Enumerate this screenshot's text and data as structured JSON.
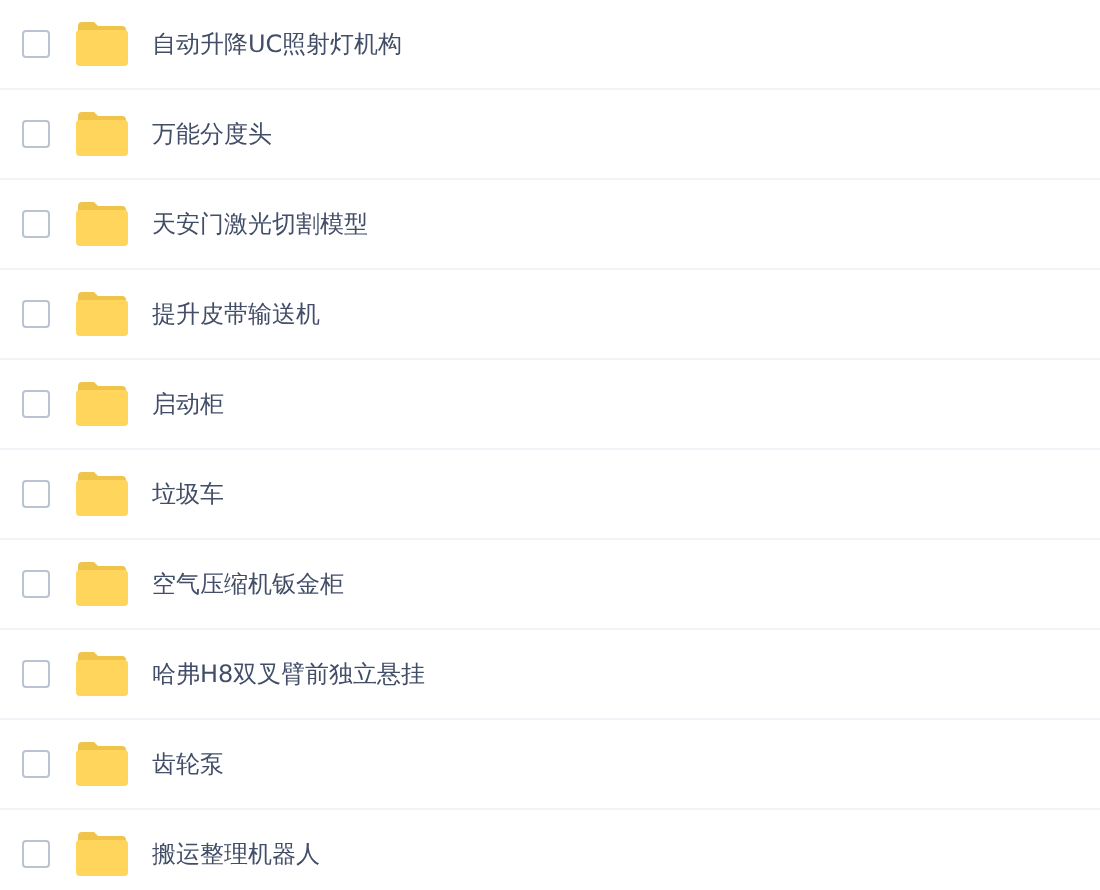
{
  "files": [
    {
      "name": "自动升降UC照射灯机构",
      "checked": false
    },
    {
      "name": "万能分度头",
      "checked": false
    },
    {
      "name": "天安门激光切割模型",
      "checked": false
    },
    {
      "name": "提升皮带输送机",
      "checked": false
    },
    {
      "name": "启动柜",
      "checked": false
    },
    {
      "name": "垃圾车",
      "checked": false
    },
    {
      "name": "空气压缩机钣金柜",
      "checked": false
    },
    {
      "name": "哈弗H8双叉臂前独立悬挂",
      "checked": false
    },
    {
      "name": "齿轮泵",
      "checked": false
    },
    {
      "name": "搬运整理机器人",
      "checked": false
    }
  ]
}
